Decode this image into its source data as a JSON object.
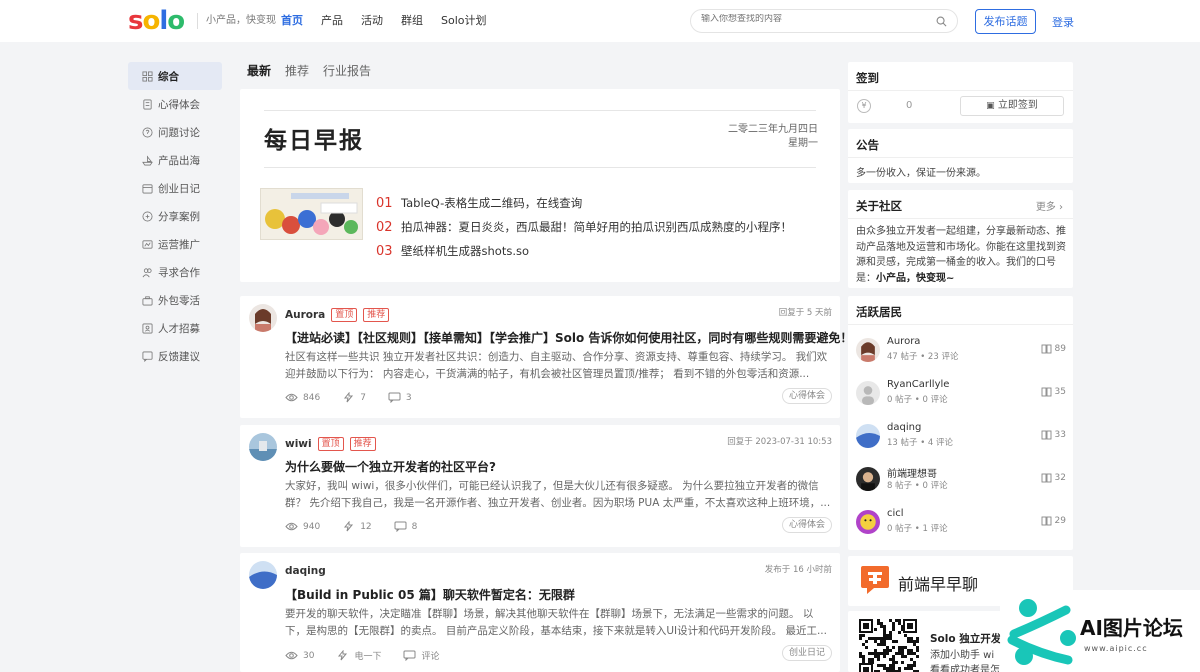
{
  "brand": {
    "logo_letters": [
      "s",
      "o",
      "l",
      "o"
    ],
    "logo_colors": [
      "#e8363c",
      "#f6b400",
      "#2e6de1",
      "#2dbb6b"
    ],
    "slogan": "小产品，快变现",
    "accent": "#2e6de1"
  },
  "nav": {
    "items": [
      "首页",
      "产品",
      "活动",
      "群组",
      "Solo计划"
    ],
    "active": "首页"
  },
  "search": {
    "placeholder": "输入你想查找的内容"
  },
  "header": {
    "post_button": "发布话题",
    "login": "登录"
  },
  "sidebar": {
    "items": [
      {
        "label": "综合",
        "icon": "grid-icon"
      },
      {
        "label": "心得体会",
        "icon": "document-icon"
      },
      {
        "label": "问题讨论",
        "icon": "question-icon"
      },
      {
        "label": "产品出海",
        "icon": "ship-icon"
      },
      {
        "label": "创业日记",
        "icon": "calendar-icon"
      },
      {
        "label": "分享案例",
        "icon": "share-icon"
      },
      {
        "label": "运营推广",
        "icon": "chart-icon"
      },
      {
        "label": "寻求合作",
        "icon": "users-icon"
      },
      {
        "label": "外包零活",
        "icon": "briefcase-icon"
      },
      {
        "label": "人才招募",
        "icon": "person-icon"
      },
      {
        "label": "反馈建议",
        "icon": "feedback-icon"
      }
    ],
    "active": "综合"
  },
  "feed_tabs": {
    "items": [
      "最新",
      "推荐",
      "行业报告"
    ],
    "active": "最新"
  },
  "daily": {
    "title": "每日早报",
    "date": "二零二三年九月四日",
    "weekday": "星期一",
    "items": [
      {
        "num": "01",
        "text": "TableQ-表格生成二维码，在线查询"
      },
      {
        "num": "02",
        "text": "拍瓜神器：夏日炎炎，西瓜最甜！简单好用的拍瓜识别西瓜成熟度的小程序！"
      },
      {
        "num": "03",
        "text": "壁纸样机生成器shots.so"
      }
    ]
  },
  "posts": [
    {
      "author": "Aurora",
      "tags": [
        "置顶",
        "推荐"
      ],
      "meta": "回复于 5 天前",
      "title": "【进站必读】【社区规则】【接单需知】【学会推广】Solo 告诉你如何使用社区，同时有哪些规则需要避免！",
      "excerpt": "社区有这样一些共识 独立开发者社区共识：创造力、自主驱动、合作分享、资源支持、尊重包容、持续学习。 我们欢迎并鼓励以下行为： 内容走心，干货满满的帖子，有机会被社区管理员置顶/推荐； 看到不错的外包零活和资源...",
      "views": "846",
      "likes": "7",
      "comments": "3",
      "category": "心得体会"
    },
    {
      "author": "wiwi",
      "tags": [
        "置顶",
        "推荐"
      ],
      "meta": "回复于 2023-07-31 10:53",
      "title": "为什么要做一个独立开发者的社区平台?",
      "excerpt": "大家好，我叫 wiwi，很多小伙伴们，可能已经认识我了，但是大伙儿还有很多疑惑。 为什么要拉独立开发者的微信群？ 先介绍下我自己，我是一名开源作者、独立开发者、创业者。因为职场 PUA 太严重，不太喜欢这种上班环境，...",
      "views": "940",
      "likes": "12",
      "comments": "8",
      "category": "心得体会"
    },
    {
      "author": "daqing",
      "tags": [],
      "meta": "发布于 16 小时前",
      "title": "【Build in Public 05 篇】聊天软件暂定名：无限群",
      "excerpt": "要开发的聊天软件，决定瞄准【群聊】场景，解决其他聊天软件在【群聊】场景下，无法满足一些需求的问题。 以下，是构思的【无限群】的卖点。 目前产品定义阶段，基本结束，接下来就是转入UI设计和代码开发阶段。 最近工...",
      "views": "30",
      "likes": "电一下",
      "comments": "评论",
      "category": "创业日记"
    }
  ],
  "checkin": {
    "title": "签到",
    "count": "0",
    "button": "立即签到"
  },
  "notice": {
    "title": "公告",
    "text": "多一份收入，保证一份来源。"
  },
  "about": {
    "title": "关于社区",
    "more": "更多",
    "text": "由众多独立开发者一起组建，分享最新动态、推动产品落地及运营和市场化。你能在这里找到资源和灵感，完成第一桶金的收入。我们的口号是：",
    "slogan": "小产品，快变现~"
  },
  "active_users": {
    "title": "活跃居民",
    "users": [
      {
        "name": "Aurora",
        "stats": "47 帖子 • 23 评论",
        "count": "89"
      },
      {
        "name": "RyanCarllyle",
        "stats": "0 帖子 • 0 评论",
        "count": "35"
      },
      {
        "name": "daqing",
        "stats": "13 帖子 • 4 评论",
        "count": "33"
      },
      {
        "name": "前端理想哥",
        "stats": "8 帖子 • 0 评论",
        "count": "32"
      },
      {
        "name": "cicl",
        "stats": "0 帖子 • 1 评论",
        "count": "29"
      }
    ]
  },
  "promo": {
    "title": "前端早早聊"
  },
  "qr": {
    "name": "Solo 独立开发",
    "line1": "添加小助手 wi",
    "line2": "看看成功者是怎"
  },
  "watermark": {
    "title": "AI图片论坛",
    "url": "www.aipic.cc"
  }
}
